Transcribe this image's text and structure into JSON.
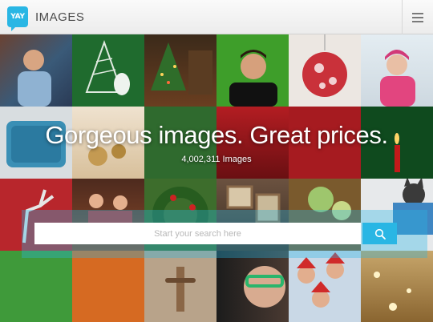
{
  "header": {
    "logo_text": "YAY",
    "brand": "IMAGES",
    "menu_icon": "hamburger-icon"
  },
  "hero": {
    "title": "Gorgeous images. Great prices.",
    "count": "4,002,311 Images"
  },
  "search": {
    "placeholder": "Start your search here",
    "button_icon": "search-icon"
  },
  "colors": {
    "accent": "#29b6e4",
    "header_bg": "#f3f3f3"
  }
}
